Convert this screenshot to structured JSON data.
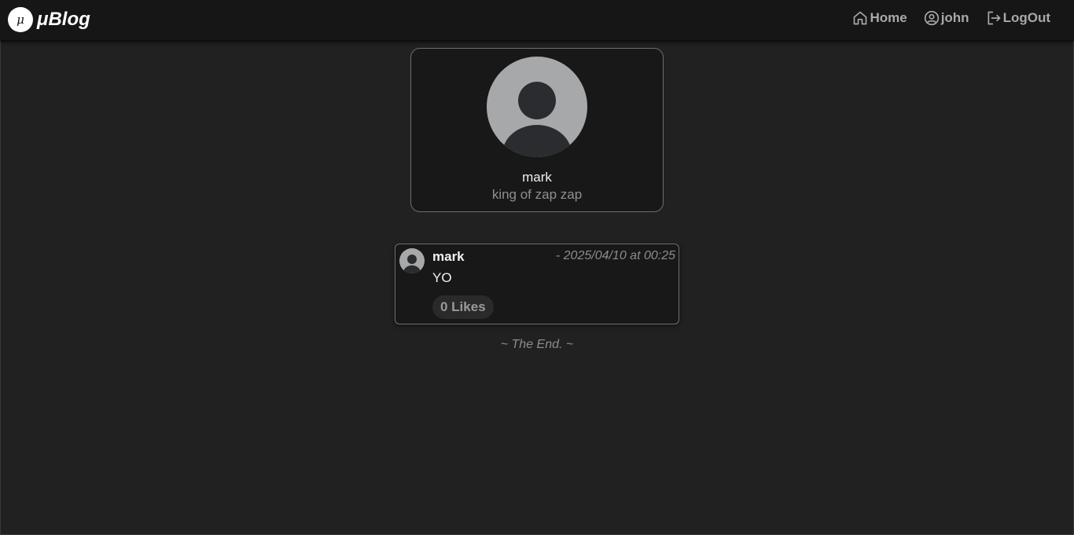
{
  "app": {
    "logo_glyph": "μ",
    "name": "μBlog"
  },
  "nav": {
    "home_label": "Home",
    "user_label": "john",
    "logout_label": "LogOut"
  },
  "profile": {
    "name": "mark",
    "bio": "king of zap zap"
  },
  "posts": [
    {
      "author": "mark",
      "timestamp": "- 2025/04/10 at 00:25",
      "body": "YO",
      "likes_label": "0 Likes"
    }
  ],
  "footer": {
    "end_text": "~ The End. ~"
  },
  "colors": {
    "background": "#212121",
    "navbar": "#161616",
    "card": "#181818",
    "muted_text": "#8c8c8c"
  }
}
